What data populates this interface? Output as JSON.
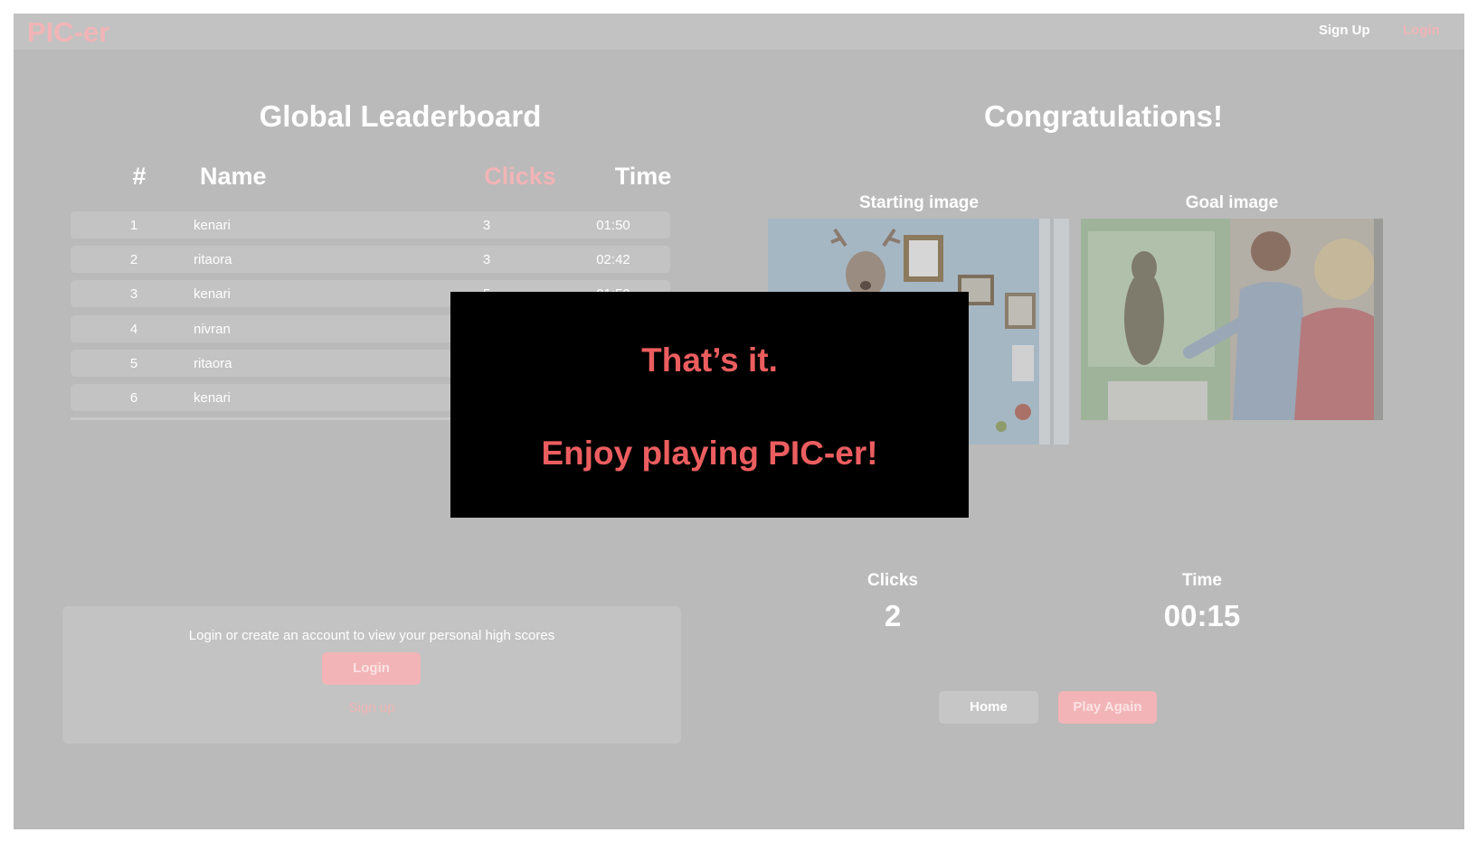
{
  "navbar": {
    "brand": "PIC-er",
    "signup_label": "Sign Up",
    "login_label": "Login"
  },
  "leaderboard": {
    "title": "Global Leaderboard",
    "columns": {
      "rank": "#",
      "name": "Name",
      "clicks": "Clicks",
      "time": "Time"
    },
    "rows": [
      {
        "rank": "1",
        "name": "kenari",
        "clicks": "3",
        "time": "01:50"
      },
      {
        "rank": "2",
        "name": "ritaora",
        "clicks": "3",
        "time": "02:42"
      },
      {
        "rank": "3",
        "name": "kenari",
        "clicks": "5",
        "time": "01:50"
      },
      {
        "rank": "4",
        "name": "nivran",
        "clicks": "",
        "time": ""
      },
      {
        "rank": "5",
        "name": "ritaora",
        "clicks": "",
        "time": ""
      },
      {
        "rank": "6",
        "name": "kenari",
        "clicks": "",
        "time": ""
      }
    ]
  },
  "personal": {
    "message": "Login or create an account to view your personal high scores",
    "login_label": "Login",
    "signup_label": "Sign up"
  },
  "results": {
    "title": "Congratulations!",
    "starting_image_label": "Starting image",
    "goal_image_label": "Goal image",
    "clicks_label": "Clicks",
    "clicks_value": "2",
    "time_label": "Time",
    "time_value": "00:15",
    "home_label": "Home",
    "play_again_label": "Play Again"
  },
  "popup": {
    "line1": "That’s it.",
    "line2": "Enjoy playing PIC-er!"
  },
  "colors": {
    "accent": "#f2b4b6",
    "overlay_gray": "#bababa",
    "popup_text": "#ec5d5f",
    "popup_bg": "#000000"
  }
}
